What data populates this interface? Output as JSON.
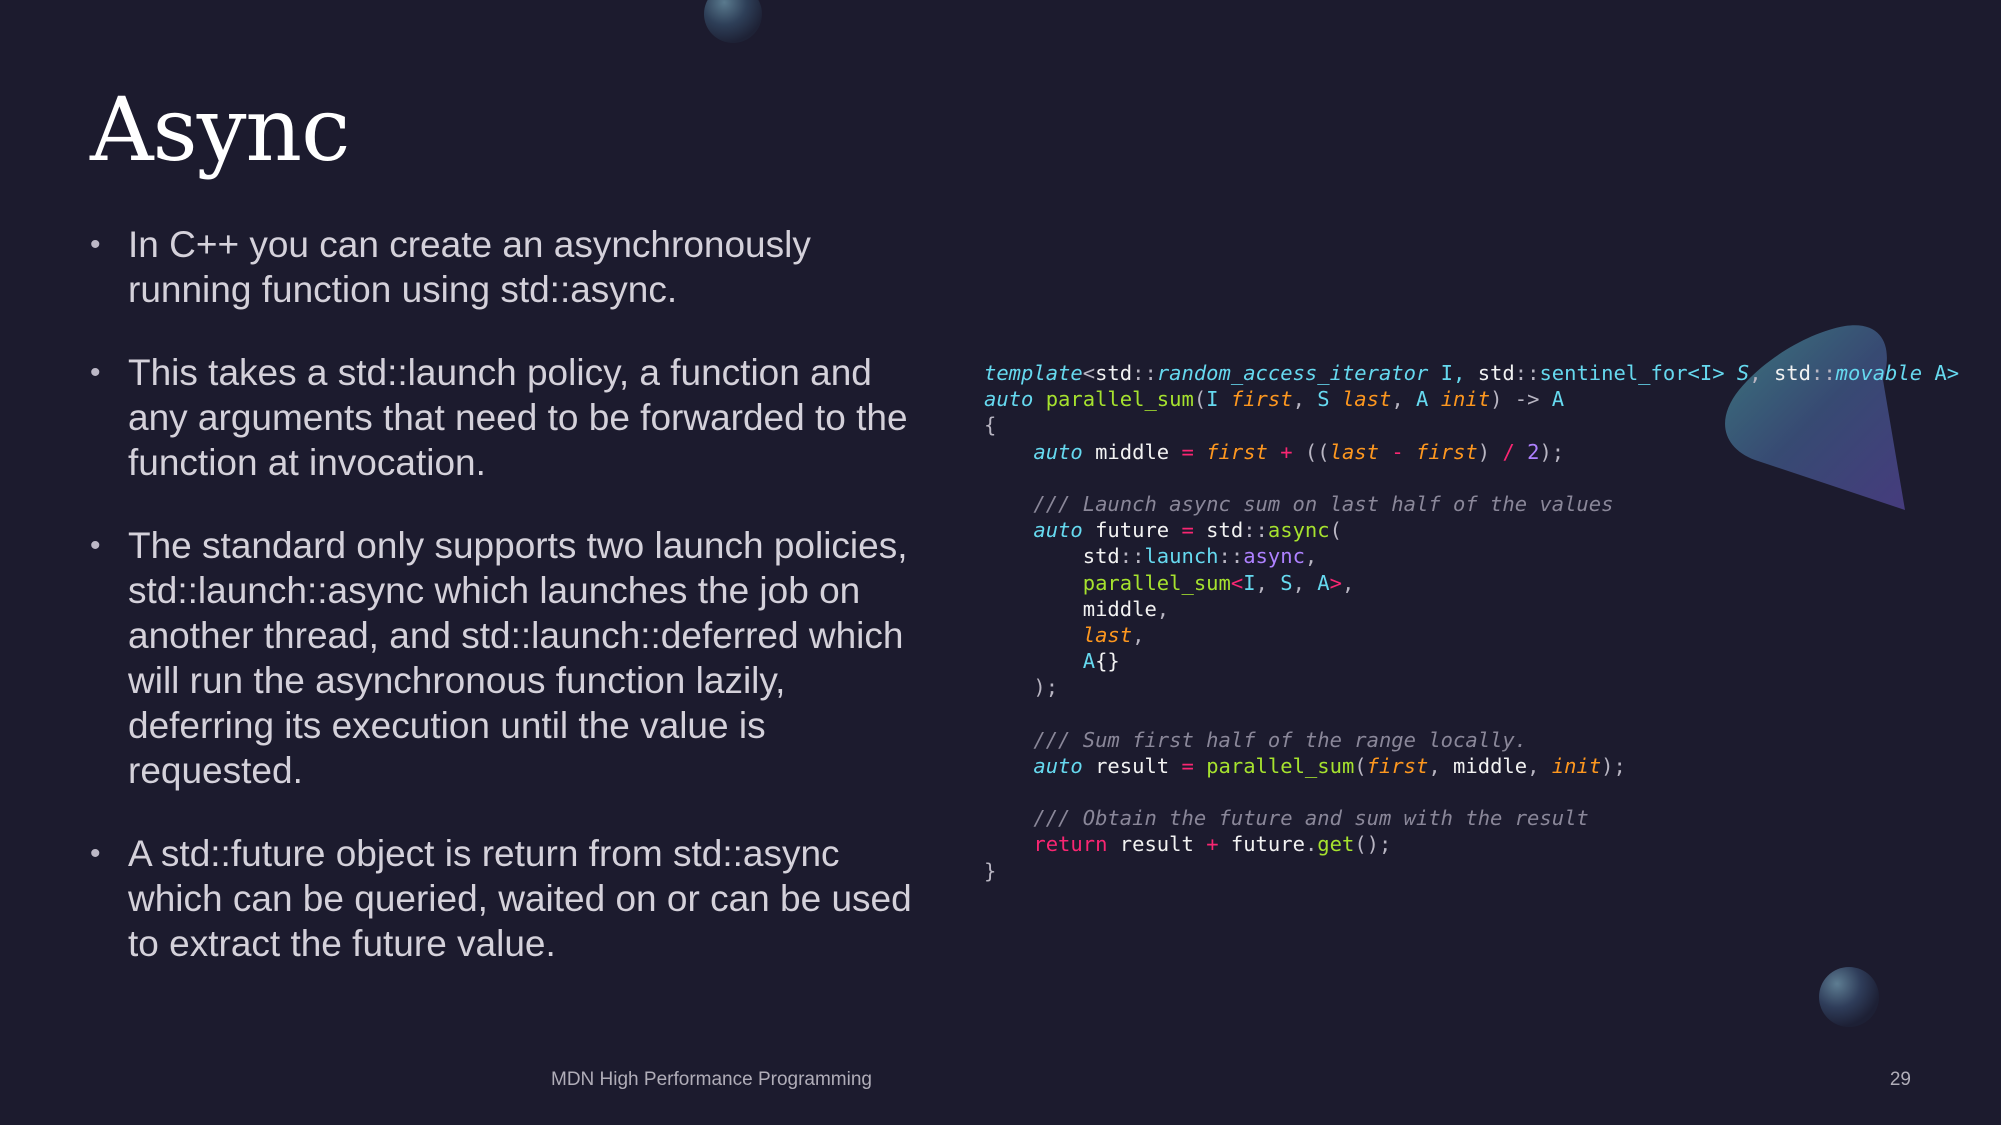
{
  "slide": {
    "title": "Async",
    "bullets": [
      "In C++ you can create an asynchronously running function using std::async.",
      "This takes a std::launch policy, a function and any arguments that need to be forwarded to the function at invocation.",
      "The standard only supports two launch policies, std::launch::async which launches the job on another thread, and std::launch::deferred which will run the asynchronous function lazily, deferring its execution until the value is requested.",
      "A std::future object is return from std::async which can be queried, waited on or can be used to extract the future value."
    ],
    "bullet_glyph": "•",
    "footer": "MDN High Performance Programming",
    "page_number": "29"
  },
  "colors": {
    "background": "#1c1b2e",
    "keyword_cyan": "#66d9ef",
    "function_green": "#a6e22e",
    "param_orange": "#fd971f",
    "operator_pink": "#f92672",
    "number_purple": "#ae81ff",
    "comment_gray": "#8a8799",
    "plain": "#f2f2f2",
    "punct": "#b8b5c2"
  },
  "code": [
    [
      [
        "template",
        "c",
        "i"
      ],
      [
        "<",
        "p"
      ],
      [
        "std",
        "w"
      ],
      [
        "::",
        "p"
      ],
      [
        "random_access_iterator",
        "c",
        "i"
      ],
      [
        " I, ",
        "c"
      ],
      [
        "std",
        "w"
      ],
      [
        "::",
        "p"
      ],
      [
        "sentinel_for",
        "c"
      ],
      [
        "<I> ",
        "c"
      ],
      [
        "S",
        "c",
        "i"
      ],
      [
        ", ",
        "p"
      ],
      [
        "std",
        "w"
      ],
      [
        "::",
        "p"
      ],
      [
        "movable",
        "c",
        "i"
      ],
      [
        " A>",
        "c"
      ]
    ],
    [
      [
        "auto",
        "c",
        "i"
      ],
      [
        " ",
        "w"
      ],
      [
        "parallel_sum",
        "g"
      ],
      [
        "(",
        "p"
      ],
      [
        "I ",
        "c"
      ],
      [
        "first",
        "o",
        "i"
      ],
      [
        ", ",
        "p"
      ],
      [
        "S ",
        "c"
      ],
      [
        "last",
        "o",
        "i"
      ],
      [
        ", ",
        "p"
      ],
      [
        "A ",
        "c"
      ],
      [
        "init",
        "o",
        "i"
      ],
      [
        ") -> ",
        "p"
      ],
      [
        "A",
        "c"
      ]
    ],
    [
      [
        "{",
        "p"
      ]
    ],
    [
      [
        "    ",
        "w"
      ],
      [
        "auto",
        "c",
        "i"
      ],
      [
        " middle ",
        "w"
      ],
      [
        "=",
        "r"
      ],
      [
        " ",
        "w"
      ],
      [
        "first",
        "o",
        "i"
      ],
      [
        " ",
        "w"
      ],
      [
        "+",
        "r"
      ],
      [
        " ((",
        "p"
      ],
      [
        "last",
        "o",
        "i"
      ],
      [
        " ",
        "w"
      ],
      [
        "-",
        "r"
      ],
      [
        " ",
        "w"
      ],
      [
        "first",
        "o",
        "i"
      ],
      [
        ") ",
        "p"
      ],
      [
        "/",
        "r"
      ],
      [
        " ",
        "w"
      ],
      [
        "2",
        "n"
      ],
      [
        ");",
        "p"
      ]
    ],
    [
      [
        "",
        "w"
      ]
    ],
    [
      [
        "    ",
        "w"
      ],
      [
        "/// Launch async sum on last half of the values",
        "m",
        "i"
      ]
    ],
    [
      [
        "    ",
        "w"
      ],
      [
        "auto",
        "c",
        "i"
      ],
      [
        " future ",
        "w"
      ],
      [
        "=",
        "r"
      ],
      [
        " std",
        "w"
      ],
      [
        "::",
        "p"
      ],
      [
        "async",
        "g"
      ],
      [
        "(",
        "p"
      ]
    ],
    [
      [
        "        std",
        "w"
      ],
      [
        "::",
        "p"
      ],
      [
        "launch",
        "c"
      ],
      [
        "::",
        "p"
      ],
      [
        "async",
        "n"
      ],
      [
        ",",
        "p"
      ]
    ],
    [
      [
        "        ",
        "w"
      ],
      [
        "parallel_sum",
        "g"
      ],
      [
        "<",
        "r"
      ],
      [
        "I",
        "c"
      ],
      [
        ", ",
        "p"
      ],
      [
        "S",
        "c"
      ],
      [
        ", ",
        "p"
      ],
      [
        "A",
        "c"
      ],
      [
        ">",
        "r"
      ],
      [
        ",",
        "p"
      ]
    ],
    [
      [
        "        middle",
        "w"
      ],
      [
        ",",
        "p"
      ]
    ],
    [
      [
        "        ",
        "w"
      ],
      [
        "last",
        "o",
        "i"
      ],
      [
        ",",
        "p"
      ]
    ],
    [
      [
        "        ",
        "w"
      ],
      [
        "A",
        "c"
      ],
      [
        "{}",
        "w"
      ]
    ],
    [
      [
        "    );",
        "p"
      ]
    ],
    [
      [
        "",
        "w"
      ]
    ],
    [
      [
        "    ",
        "w"
      ],
      [
        "/// Sum first half of the range locally.",
        "m",
        "i"
      ]
    ],
    [
      [
        "    ",
        "w"
      ],
      [
        "auto",
        "c",
        "i"
      ],
      [
        " result ",
        "w"
      ],
      [
        "=",
        "r"
      ],
      [
        " ",
        "w"
      ],
      [
        "parallel_sum",
        "g"
      ],
      [
        "(",
        "p"
      ],
      [
        "first",
        "o",
        "i"
      ],
      [
        ", ",
        "p"
      ],
      [
        "middle",
        "w"
      ],
      [
        ", ",
        "p"
      ],
      [
        "init",
        "o",
        "i"
      ],
      [
        ");",
        "p"
      ]
    ],
    [
      [
        "",
        "w"
      ]
    ],
    [
      [
        "    ",
        "w"
      ],
      [
        "/// Obtain the future and sum with the result",
        "m",
        "i"
      ]
    ],
    [
      [
        "    ",
        "w"
      ],
      [
        "return",
        "r"
      ],
      [
        " result ",
        "w"
      ],
      [
        "+",
        "r"
      ],
      [
        " future",
        "w"
      ],
      [
        ".",
        "p"
      ],
      [
        "get",
        "g"
      ],
      [
        "();",
        "p"
      ]
    ],
    [
      [
        "}",
        "p"
      ]
    ]
  ]
}
